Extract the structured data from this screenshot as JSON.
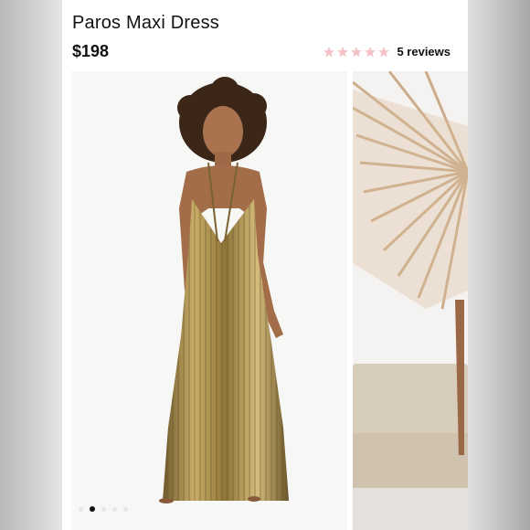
{
  "product": {
    "title": "Paros Maxi Dress",
    "price": "$198",
    "rating": {
      "stars_filled": 0,
      "stars_total": 5,
      "reviews_label": "5 reviews"
    }
  },
  "gallery": {
    "total_images": 5,
    "active_index": 1
  },
  "colors": {
    "star": "#f3c3c7",
    "dress_gold": "#b89a54",
    "dot_active": "#111111"
  }
}
